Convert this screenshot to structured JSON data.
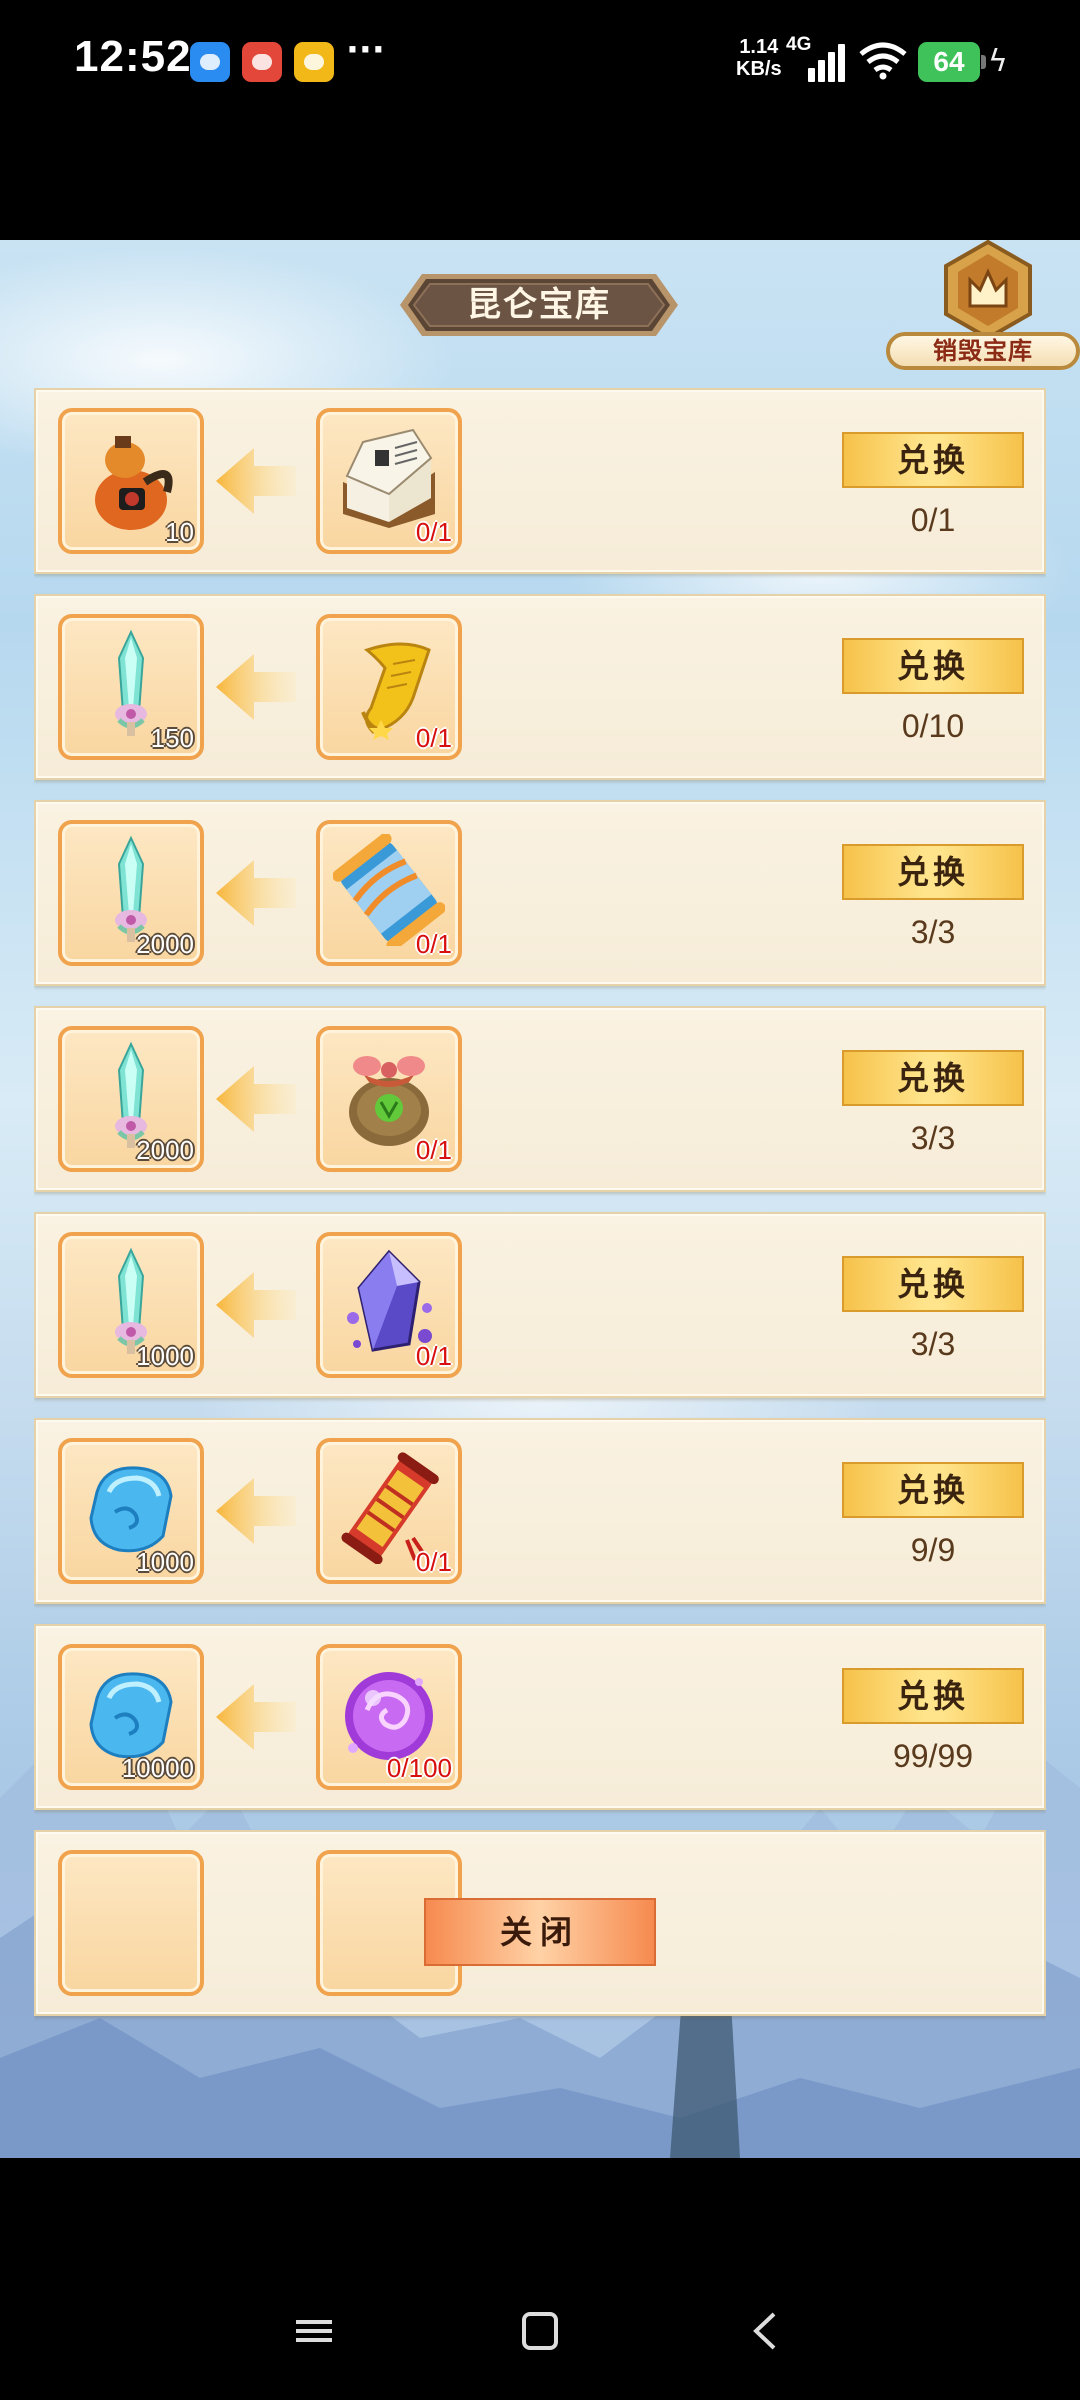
{
  "status_bar": {
    "time": "12:52",
    "apps": [
      "weather-app-icon",
      "message-app-icon",
      "weibo-app-icon"
    ],
    "more": "···",
    "net_speed_value": "1.14",
    "net_speed_unit": "KB/s",
    "network_type": "4G",
    "battery": "64"
  },
  "header": {
    "title": "昆仑宝库",
    "destroy_label": "销毁宝库"
  },
  "rows": [
    {
      "cost_icon": "gourd-icon",
      "cost_count": "10",
      "reward_icon": "book-icon",
      "reward_need": "0/1",
      "button": "兑换",
      "progress": "0/1"
    },
    {
      "cost_icon": "jade-sword-icon",
      "cost_count": "150",
      "reward_icon": "gold-scroll-icon",
      "reward_need": "0/1",
      "button": "兑换",
      "progress": "0/10"
    },
    {
      "cost_icon": "jade-sword-icon",
      "cost_count": "2000",
      "reward_icon": "blue-scroll-icon",
      "reward_need": "0/1",
      "button": "兑换",
      "progress": "3/3"
    },
    {
      "cost_icon": "jade-sword-icon",
      "cost_count": "2000",
      "reward_icon": "green-bag-icon",
      "reward_need": "0/1",
      "button": "兑换",
      "progress": "3/3"
    },
    {
      "cost_icon": "jade-sword-icon",
      "cost_count": "1000",
      "reward_icon": "purple-crystal-icon",
      "reward_need": "0/1",
      "button": "兑换",
      "progress": "3/3"
    },
    {
      "cost_icon": "blue-gem-icon",
      "cost_count": "1000",
      "reward_icon": "red-scroll-icon",
      "reward_need": "0/1",
      "button": "兑换",
      "progress": "9/9"
    },
    {
      "cost_icon": "blue-gem-icon",
      "cost_count": "10000",
      "reward_icon": "purple-orb-icon",
      "reward_need": "0/100",
      "button": "兑换",
      "progress": "99/99"
    }
  ],
  "close_button": "关闭",
  "colors": {
    "slot_border": "#f0a24c",
    "exchange_button": "#f6c24a",
    "close_button": "#f68a4f",
    "need_text": "#d80f0f",
    "battery": "#3fc25a"
  }
}
